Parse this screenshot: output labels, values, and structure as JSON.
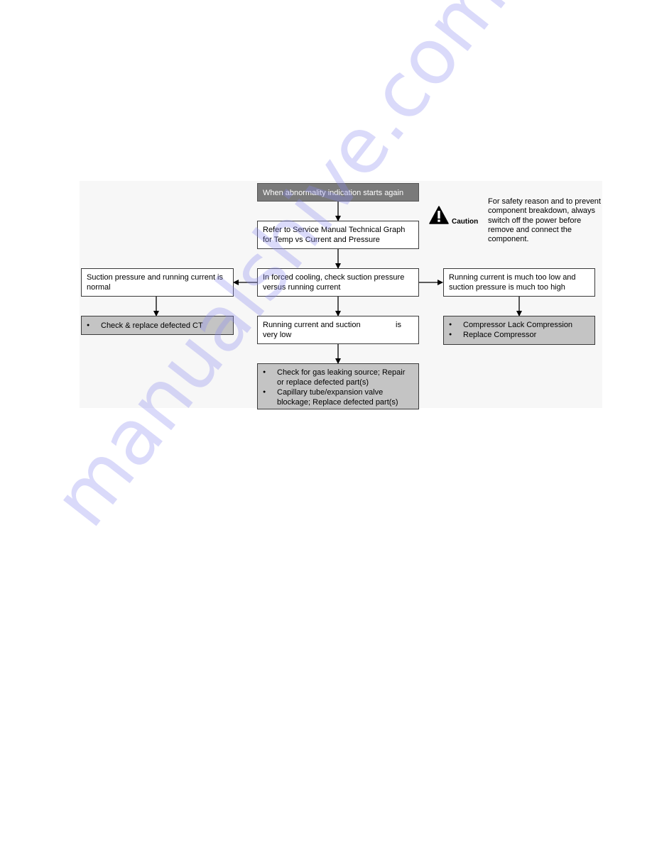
{
  "flowchart": {
    "start": {
      "text": "When abnormality indication starts again"
    },
    "refer": {
      "text": "Refer to Service Manual Technical Graph for Temp vs Current and Pressure"
    },
    "check": {
      "text": "In forced cooling, check suction pressure versus running current"
    },
    "left_condition": {
      "text": "Suction pressure and running current is normal"
    },
    "left_action": {
      "items": [
        "Check & replace defected CT"
      ]
    },
    "center_condition": {
      "text_line1": "Running current and suction",
      "text_gap": "is",
      "text_line2": "very low"
    },
    "center_action": {
      "items": [
        "Check for gas leaking source; Repair or replace defected part(s)",
        "Capillary tube/expansion valve blockage; Replace defected part(s)"
      ]
    },
    "right_condition": {
      "text": "Running current is much too low and suction pressure is much too high"
    },
    "right_action": {
      "items": [
        "Compressor Lack Compression",
        "Replace Compressor"
      ]
    }
  },
  "caution": {
    "icon": "warning-triangle-icon",
    "label": "Caution",
    "text": "For safety reason and to prevent component breakdown, always switch off the power before remove and connect the component."
  },
  "watermark": {
    "text": "manualshive.com"
  },
  "colors": {
    "start_fill": "#7a7a7a",
    "action_fill": "#c4c4c4",
    "diagram_bg": "#f7f7f7",
    "watermark": "#8c8cf0"
  }
}
